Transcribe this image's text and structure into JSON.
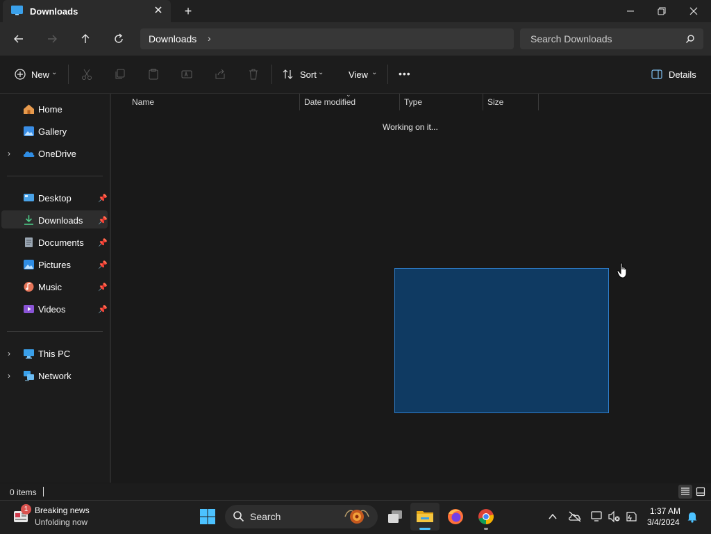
{
  "window": {
    "tab_title": "Downloads",
    "new_tab_label": "+",
    "close_tab_label": "✕"
  },
  "nav": {
    "address": "Downloads",
    "search_placeholder": "Search Downloads"
  },
  "toolbar": {
    "new_label": "New",
    "sort_label": "Sort",
    "view_label": "View",
    "more_label": "•••",
    "details_label": "Details"
  },
  "sidebar": {
    "top": [
      {
        "label": "Home",
        "icon": "home-icon"
      },
      {
        "label": "Gallery",
        "icon": "gallery-icon"
      },
      {
        "label": "OneDrive",
        "icon": "onedrive-icon"
      }
    ],
    "pinned": [
      {
        "label": "Desktop",
        "icon": "desktop-icon"
      },
      {
        "label": "Downloads",
        "icon": "download-icon",
        "selected": true
      },
      {
        "label": "Documents",
        "icon": "documents-icon"
      },
      {
        "label": "Pictures",
        "icon": "pictures-icon"
      },
      {
        "label": "Music",
        "icon": "music-icon"
      },
      {
        "label": "Videos",
        "icon": "videos-icon"
      }
    ],
    "bottom": [
      {
        "label": "This PC",
        "icon": "pc-icon"
      },
      {
        "label": "Network",
        "icon": "network-icon"
      }
    ]
  },
  "content": {
    "columns": [
      "Name",
      "Date modified",
      "Type",
      "Size"
    ],
    "status_message": "Working on it..."
  },
  "statusbar": {
    "items_text": "0 items"
  },
  "taskbar": {
    "news_title": "Breaking news",
    "news_subtitle": "Unfolding now",
    "news_badge": "1",
    "search_label": "Search",
    "time": "1:37 AM",
    "date": "3/4/2024"
  },
  "colors": {
    "accent": "#0078d4",
    "selection_fill": "#0f3a62",
    "selection_border": "#2f7ecb"
  }
}
